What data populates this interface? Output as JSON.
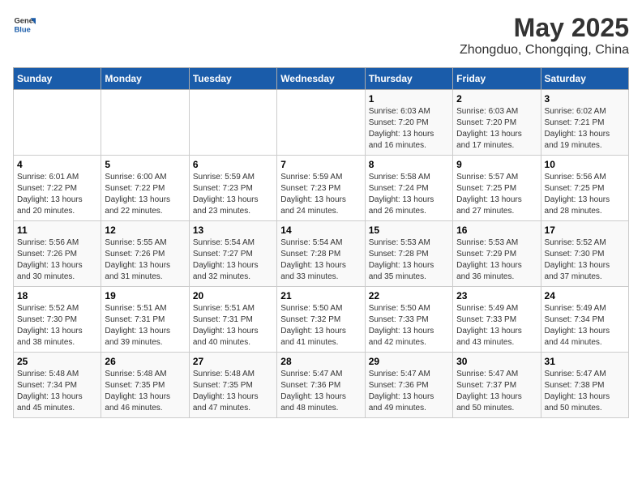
{
  "header": {
    "logo_line1": "General",
    "logo_line2": "Blue",
    "title": "May 2025",
    "subtitle": "Zhongduo, Chongqing, China"
  },
  "weekdays": [
    "Sunday",
    "Monday",
    "Tuesday",
    "Wednesday",
    "Thursday",
    "Friday",
    "Saturday"
  ],
  "weeks": [
    [
      {
        "day": "",
        "info": ""
      },
      {
        "day": "",
        "info": ""
      },
      {
        "day": "",
        "info": ""
      },
      {
        "day": "",
        "info": ""
      },
      {
        "day": "1",
        "info": "Sunrise: 6:03 AM\nSunset: 7:20 PM\nDaylight: 13 hours\nand 16 minutes."
      },
      {
        "day": "2",
        "info": "Sunrise: 6:03 AM\nSunset: 7:20 PM\nDaylight: 13 hours\nand 17 minutes."
      },
      {
        "day": "3",
        "info": "Sunrise: 6:02 AM\nSunset: 7:21 PM\nDaylight: 13 hours\nand 19 minutes."
      }
    ],
    [
      {
        "day": "4",
        "info": "Sunrise: 6:01 AM\nSunset: 7:22 PM\nDaylight: 13 hours\nand 20 minutes."
      },
      {
        "day": "5",
        "info": "Sunrise: 6:00 AM\nSunset: 7:22 PM\nDaylight: 13 hours\nand 22 minutes."
      },
      {
        "day": "6",
        "info": "Sunrise: 5:59 AM\nSunset: 7:23 PM\nDaylight: 13 hours\nand 23 minutes."
      },
      {
        "day": "7",
        "info": "Sunrise: 5:59 AM\nSunset: 7:23 PM\nDaylight: 13 hours\nand 24 minutes."
      },
      {
        "day": "8",
        "info": "Sunrise: 5:58 AM\nSunset: 7:24 PM\nDaylight: 13 hours\nand 26 minutes."
      },
      {
        "day": "9",
        "info": "Sunrise: 5:57 AM\nSunset: 7:25 PM\nDaylight: 13 hours\nand 27 minutes."
      },
      {
        "day": "10",
        "info": "Sunrise: 5:56 AM\nSunset: 7:25 PM\nDaylight: 13 hours\nand 28 minutes."
      }
    ],
    [
      {
        "day": "11",
        "info": "Sunrise: 5:56 AM\nSunset: 7:26 PM\nDaylight: 13 hours\nand 30 minutes."
      },
      {
        "day": "12",
        "info": "Sunrise: 5:55 AM\nSunset: 7:26 PM\nDaylight: 13 hours\nand 31 minutes."
      },
      {
        "day": "13",
        "info": "Sunrise: 5:54 AM\nSunset: 7:27 PM\nDaylight: 13 hours\nand 32 minutes."
      },
      {
        "day": "14",
        "info": "Sunrise: 5:54 AM\nSunset: 7:28 PM\nDaylight: 13 hours\nand 33 minutes."
      },
      {
        "day": "15",
        "info": "Sunrise: 5:53 AM\nSunset: 7:28 PM\nDaylight: 13 hours\nand 35 minutes."
      },
      {
        "day": "16",
        "info": "Sunrise: 5:53 AM\nSunset: 7:29 PM\nDaylight: 13 hours\nand 36 minutes."
      },
      {
        "day": "17",
        "info": "Sunrise: 5:52 AM\nSunset: 7:30 PM\nDaylight: 13 hours\nand 37 minutes."
      }
    ],
    [
      {
        "day": "18",
        "info": "Sunrise: 5:52 AM\nSunset: 7:30 PM\nDaylight: 13 hours\nand 38 minutes."
      },
      {
        "day": "19",
        "info": "Sunrise: 5:51 AM\nSunset: 7:31 PM\nDaylight: 13 hours\nand 39 minutes."
      },
      {
        "day": "20",
        "info": "Sunrise: 5:51 AM\nSunset: 7:31 PM\nDaylight: 13 hours\nand 40 minutes."
      },
      {
        "day": "21",
        "info": "Sunrise: 5:50 AM\nSunset: 7:32 PM\nDaylight: 13 hours\nand 41 minutes."
      },
      {
        "day": "22",
        "info": "Sunrise: 5:50 AM\nSunset: 7:33 PM\nDaylight: 13 hours\nand 42 minutes."
      },
      {
        "day": "23",
        "info": "Sunrise: 5:49 AM\nSunset: 7:33 PM\nDaylight: 13 hours\nand 43 minutes."
      },
      {
        "day": "24",
        "info": "Sunrise: 5:49 AM\nSunset: 7:34 PM\nDaylight: 13 hours\nand 44 minutes."
      }
    ],
    [
      {
        "day": "25",
        "info": "Sunrise: 5:48 AM\nSunset: 7:34 PM\nDaylight: 13 hours\nand 45 minutes."
      },
      {
        "day": "26",
        "info": "Sunrise: 5:48 AM\nSunset: 7:35 PM\nDaylight: 13 hours\nand 46 minutes."
      },
      {
        "day": "27",
        "info": "Sunrise: 5:48 AM\nSunset: 7:35 PM\nDaylight: 13 hours\nand 47 minutes."
      },
      {
        "day": "28",
        "info": "Sunrise: 5:47 AM\nSunset: 7:36 PM\nDaylight: 13 hours\nand 48 minutes."
      },
      {
        "day": "29",
        "info": "Sunrise: 5:47 AM\nSunset: 7:36 PM\nDaylight: 13 hours\nand 49 minutes."
      },
      {
        "day": "30",
        "info": "Sunrise: 5:47 AM\nSunset: 7:37 PM\nDaylight: 13 hours\nand 50 minutes."
      },
      {
        "day": "31",
        "info": "Sunrise: 5:47 AM\nSunset: 7:38 PM\nDaylight: 13 hours\nand 50 minutes."
      }
    ]
  ]
}
